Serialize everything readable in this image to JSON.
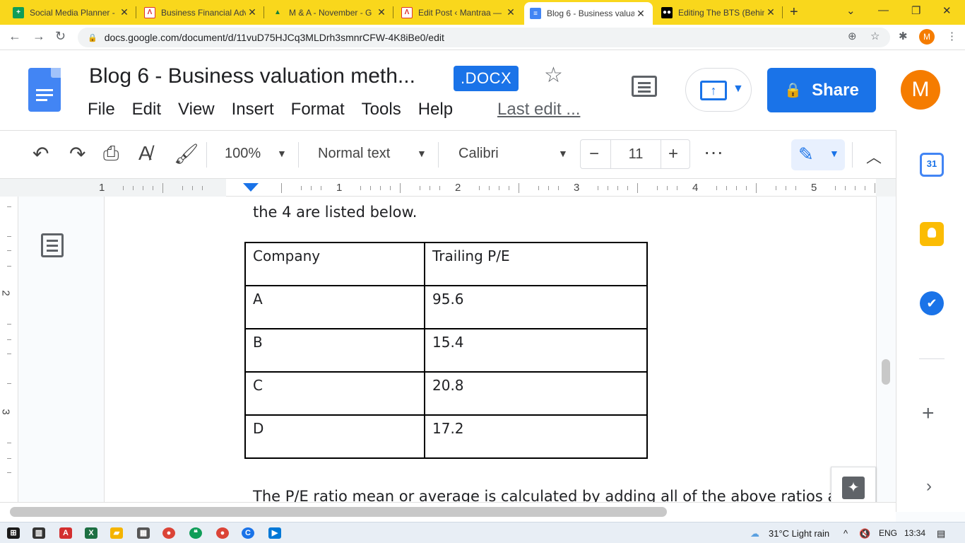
{
  "browser": {
    "tabs": [
      {
        "title": "Social Media Planner -",
        "favicon": "sheets-icon"
      },
      {
        "title": "Business Financial Adv",
        "favicon": "lambda-icon"
      },
      {
        "title": "M & A - November - G",
        "favicon": "drive-icon"
      },
      {
        "title": "Edit Post ‹ Mantraa —",
        "favicon": "lambda-icon"
      },
      {
        "title": "Blog 6 - Business valua",
        "favicon": "docs-icon",
        "active": true
      },
      {
        "title": "Editing The BTS (Behin",
        "favicon": "medium-icon"
      }
    ],
    "url": "docs.google.com/document/d/11vuD75HJCq3MLDrh3smnrCFW-4K8iBe0/edit",
    "profile_initial": "M"
  },
  "doc": {
    "title": "Blog 6 - Business valuation meth...",
    "badge": ".DOCX",
    "menu": [
      "File",
      "Edit",
      "View",
      "Insert",
      "Format",
      "Tools",
      "Help"
    ],
    "last_edit": "Last edit ...",
    "share_label": "Share",
    "avatar_initial": "M"
  },
  "toolbar": {
    "zoom": "100%",
    "style": "Normal text",
    "font": "Calibri",
    "font_size": "11"
  },
  "ruler": {
    "numbers": [
      "1",
      "1",
      "2",
      "3",
      "4",
      "5"
    ],
    "vertical_numbers": [
      "2",
      "3"
    ]
  },
  "content": {
    "intro_line": "the 4 are listed below.",
    "table": {
      "headers": [
        "Company",
        "Trailing P/E"
      ],
      "rows": [
        [
          "A",
          "95.6"
        ],
        [
          "B",
          "15.4"
        ],
        [
          "C",
          "20.8"
        ],
        [
          "D",
          "17.2"
        ]
      ]
    },
    "outro_line": "The P/E ratio mean or average is calculated by adding all of the above ratios and"
  },
  "sidepanel": {
    "calendar_day": "31"
  },
  "taskbar": {
    "weather": "31°C  Light rain",
    "language": "ENG",
    "time": "13:34"
  },
  "colors": {
    "tabstrip": "#f9d71c",
    "accent": "#1a73e8",
    "avatar": "#f57c00"
  }
}
